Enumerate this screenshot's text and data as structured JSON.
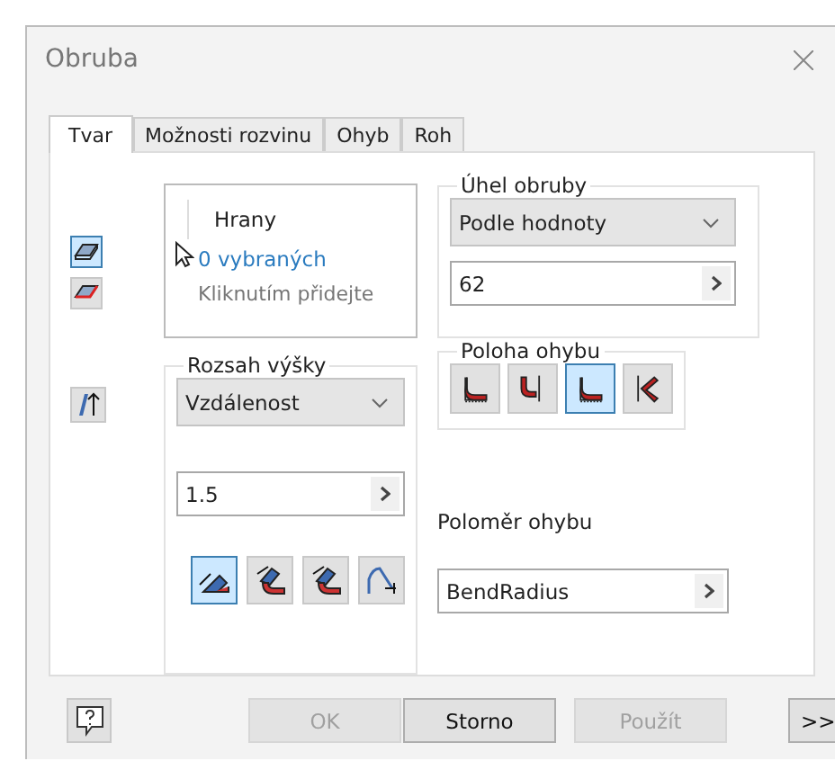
{
  "window": {
    "title": "Obruba"
  },
  "tabs": [
    {
      "label": "Tvar",
      "selected": true
    },
    {
      "label": "Možnosti rozvinu",
      "selected": false
    },
    {
      "label": "Ohyb",
      "selected": false
    },
    {
      "label": "Roh",
      "selected": false
    }
  ],
  "mode_buttons": [
    {
      "kind": "edge",
      "selected": true
    },
    {
      "kind": "loop",
      "selected": false
    }
  ],
  "edges": {
    "header": "Hrany",
    "count": "0 vybraných",
    "hint": "Kliknutím přidejte"
  },
  "flange_angle": {
    "legend": "Úhel obruby",
    "mode": "Podle hodnoty",
    "value": "62"
  },
  "height_extent": {
    "legend": "Rozsah výšky",
    "mode": "Vzdálenost",
    "value": "1.5",
    "datum_buttons": [
      {
        "kind": "outer",
        "selected": true
      },
      {
        "kind": "inner",
        "selected": false
      },
      {
        "kind": "inner",
        "selected": false
      },
      {
        "kind": "aligned",
        "selected": false
      }
    ]
  },
  "bend_position": {
    "legend": "Poloha ohybu",
    "buttons": [
      {
        "kind": "inside",
        "selected": false
      },
      {
        "kind": "outside",
        "selected": false
      },
      {
        "kind": "inside",
        "selected": true
      },
      {
        "kind": "tangent",
        "selected": false
      }
    ]
  },
  "bend_radius": {
    "label": "Poloměr ohybu",
    "value": "BendRadius"
  },
  "footer": {
    "buttons": [
      {
        "label": "OK",
        "disabled": true
      },
      {
        "label": "Storno",
        "disabled": false
      },
      {
        "label": "Použít",
        "disabled": true
      }
    ],
    "more": ">>"
  }
}
